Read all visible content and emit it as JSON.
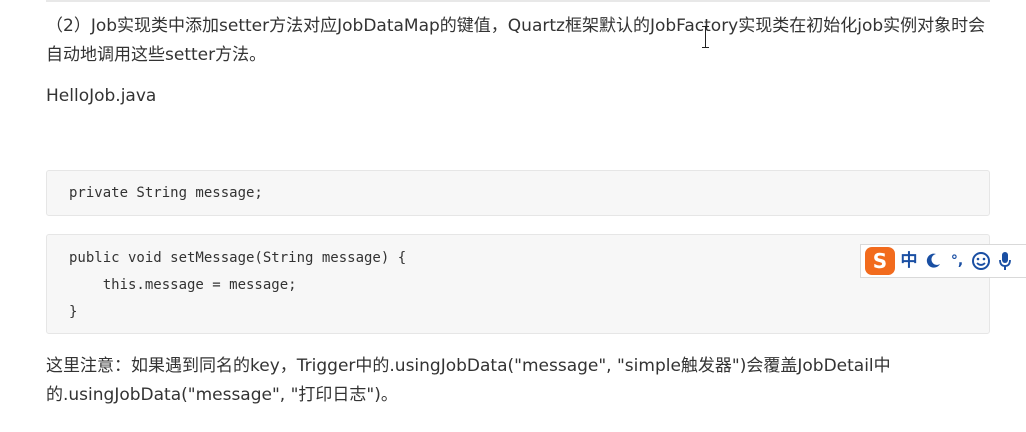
{
  "article": {
    "intro_paragraph": "（2）Job实现类中添加setter方法对应JobDataMap的键值，Quartz框架默认的JobFactory实现类在初始化job实例对象时会自动地调用这些setter方法。",
    "file_title": "HelloJob.java",
    "code_block_1": [
      "private String message;"
    ],
    "code_block_2": [
      "public void setMessage(String message) {",
      "    this.message = message;",
      "}"
    ],
    "note_paragraph": "这里注意：如果遇到同名的key，Trigger中的.usingJobData(\"message\", \"simple触发器\")会覆盖JobDetail中的.usingJobData(\"message\", \"打印日志\")。"
  },
  "ime_toolbar": {
    "logo_letter": "S",
    "mode_label": "中",
    "icons": [
      "moon-icon",
      "punctuation-icon",
      "emoji-icon",
      "microphone-icon"
    ],
    "punctuation_label": "°,",
    "brand_color": "#f26b1d",
    "icon_color": "#1a4fa3"
  }
}
